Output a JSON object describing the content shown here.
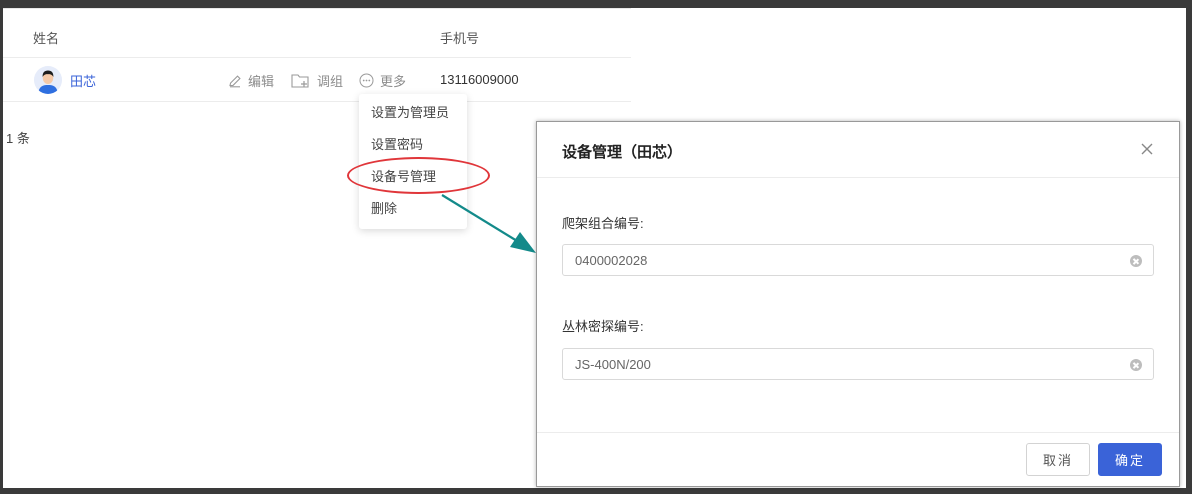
{
  "table": {
    "col_name": "姓名",
    "col_phone": "手机号",
    "row": {
      "name": "田芯",
      "edit_label": "编辑",
      "move_label": "调组",
      "more_label": "更多",
      "phone": "13116009000"
    },
    "count_text": "1 条"
  },
  "menu": {
    "items": [
      "设置为管理员",
      "设置密码",
      "设备号管理",
      "删除"
    ]
  },
  "modal": {
    "title": "设备管理（田芯）",
    "field1_label": "爬架组合编号:",
    "field1_value": "0400002028",
    "field2_label": "丛林密探编号:",
    "field2_value": "JS-400N/200",
    "cancel_label": "取消",
    "ok_label": "确定"
  },
  "colors": {
    "accent": "#3a63d8",
    "highlight": "#e0363a",
    "arrow": "#138a8a"
  }
}
